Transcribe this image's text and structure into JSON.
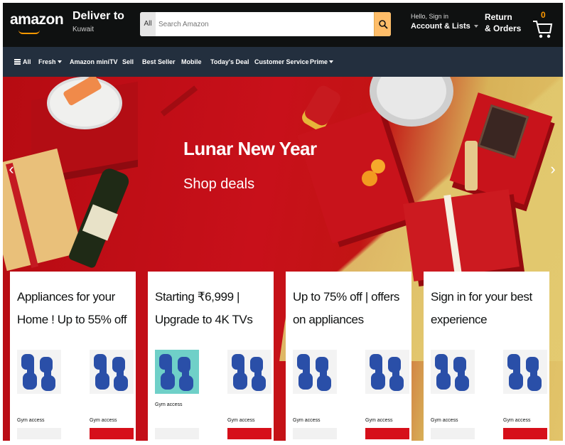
{
  "header": {
    "logo": "amazon",
    "deliver_title": "Deliver to",
    "deliver_location": "Kuwait",
    "search_category": "All",
    "search_placeholder": "Search Amazon",
    "account_hello": "Hello, Sign in",
    "account_main": "Account & Lists",
    "returns_line1": "Return",
    "returns_line2": "& Orders",
    "cart_count": "0"
  },
  "nav": {
    "items": [
      {
        "label": "All"
      },
      {
        "label": "Fresh"
      },
      {
        "label": "Amazon miniTV"
      },
      {
        "label": "Sell"
      },
      {
        "label": "Best Seller"
      },
      {
        "label": "Mobile"
      },
      {
        "label": "Today's Deal"
      },
      {
        "label": "Customer Service"
      },
      {
        "label": "Prime"
      }
    ]
  },
  "hero": {
    "title": "Lunar New Year",
    "subtitle": "Shop deals"
  },
  "cards": [
    {
      "title": "Appliances for your Home ! Up to 55% off",
      "tiles": [
        {
          "label": "Gym access"
        },
        {
          "label": "Gym access"
        }
      ]
    },
    {
      "title": "Starting ₹6,999 | Upgrade to 4K TVs",
      "tiles": [
        {
          "label": "Gym access"
        },
        {
          "label": "Gym access"
        }
      ]
    },
    {
      "title": "Up to 75% off | offers on appliances",
      "tiles": [
        {
          "label": "Gym access"
        },
        {
          "label": "Gym access"
        }
      ]
    },
    {
      "title": "Sign in for your best experience",
      "tiles": [
        {
          "label": "Gym access"
        },
        {
          "label": "Gym access"
        }
      ]
    }
  ],
  "colors": {
    "header_bg": "#0f1111",
    "nav_bg": "#232f3e",
    "search_button": "#febd69",
    "accent": "#ff9900",
    "hero_red": "#c8101a",
    "dumbbell_blue": "#2a4fa8"
  },
  "icons": [
    "search-icon",
    "cart-icon",
    "hamburger-icon",
    "chevron-left-icon",
    "chevron-right-icon",
    "dumbbell-icon"
  ]
}
